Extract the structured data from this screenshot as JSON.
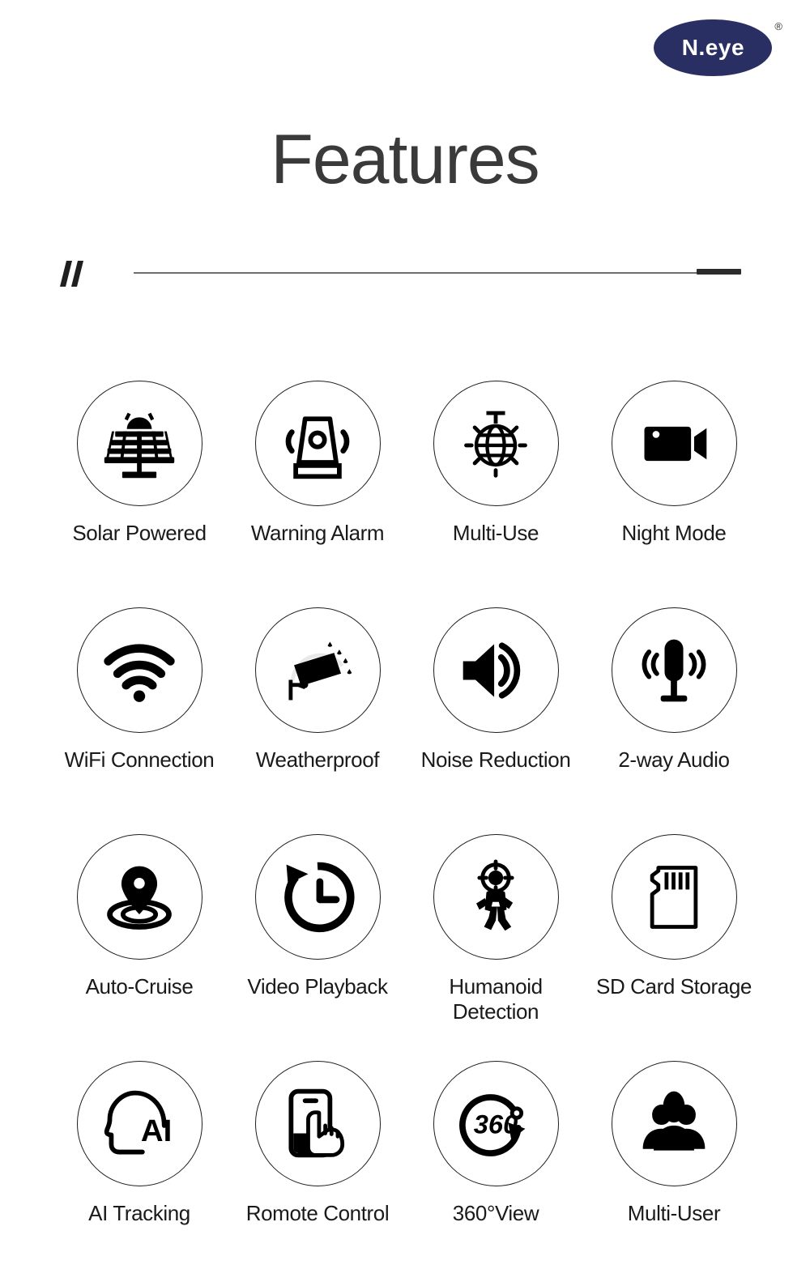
{
  "brand": {
    "name": "N.eye",
    "trademark": "®",
    "ellipse_color": "#2a2f63",
    "text_color": "#ffffff"
  },
  "header": {
    "title": "Features",
    "title_color": "#3a3a3a"
  },
  "divider": {
    "slash_mark": "//",
    "line_color": "#6f6f6f",
    "cap_color": "#2b2b2b"
  },
  "features": [
    {
      "label": "Solar Powered",
      "icon": "solar-panel-icon"
    },
    {
      "label": "Warning Alarm",
      "icon": "siren-alarm-icon"
    },
    {
      "label": "Multi-Use",
      "icon": "disco-globe-icon"
    },
    {
      "label": "Night Mode",
      "icon": "night-camera-moon-icon"
    },
    {
      "label": "WiFi Connection",
      "icon": "wifi-signal-icon"
    },
    {
      "label": "Weatherproof",
      "icon": "camera-rain-icon"
    },
    {
      "label": "Noise Reduction",
      "icon": "speaker-waves-icon"
    },
    {
      "label": "2-way Audio",
      "icon": "microphone-waves-icon"
    },
    {
      "label": "Auto-Cruise",
      "icon": "location-pin-ripple-icon"
    },
    {
      "label": "Video Playback",
      "icon": "clock-rewind-icon"
    },
    {
      "label": "Humanoid\nDetection",
      "icon": "human-target-icon"
    },
    {
      "label": "SD Card Storage",
      "icon": "sd-card-icon"
    },
    {
      "label": "AI Tracking",
      "icon": "ai-head-icon"
    },
    {
      "label": "Romote Control",
      "icon": "phone-touch-icon"
    },
    {
      "label": "360°View",
      "icon": "360-rotation-icon"
    },
    {
      "label": "Multi-User",
      "icon": "users-group-icon"
    }
  ],
  "colors": {
    "background": "#ffffff",
    "icon": "#000000",
    "text": "#1a1a1a",
    "circle_border": "#1d1d1d"
  }
}
